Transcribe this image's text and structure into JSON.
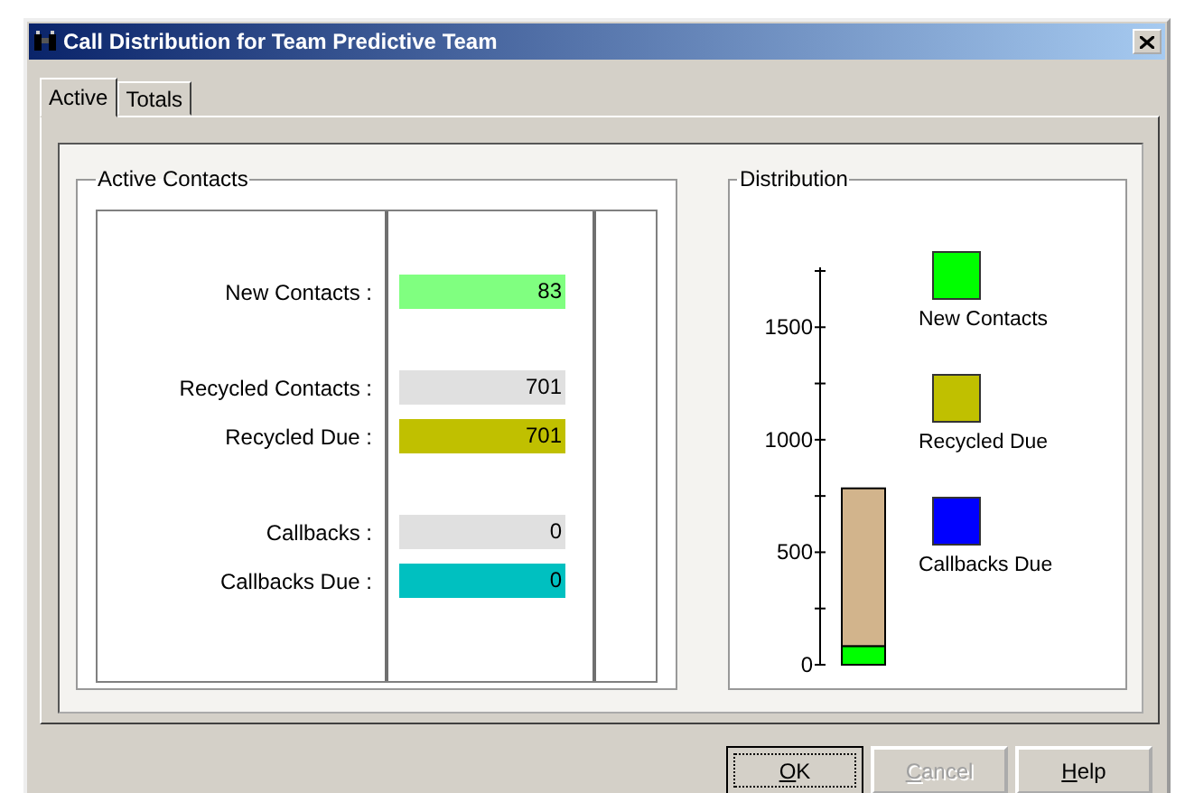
{
  "window": {
    "title": "Call Distribution for Team Predictive Team"
  },
  "tabs": [
    {
      "label": "Active",
      "selected": true
    },
    {
      "label": "Totals",
      "selected": false
    }
  ],
  "active_contacts": {
    "title": "Active Contacts",
    "groups": [
      {
        "rows": [
          {
            "label": "New Contacts :",
            "value": "83",
            "color": "#80ff80"
          }
        ]
      },
      {
        "rows": [
          {
            "label": "Recycled Contacts :",
            "value": "701",
            "color": "#e0e0e0"
          },
          {
            "label": "Recycled Due :",
            "value": "701",
            "color": "#c0c000"
          }
        ]
      },
      {
        "rows": [
          {
            "label": "Callbacks :",
            "value": "0",
            "color": "#e0e0e0"
          },
          {
            "label": "Callbacks Due :",
            "value": "0",
            "color": "#00c0c0"
          }
        ]
      }
    ]
  },
  "distribution": {
    "title": "Distribution",
    "chart_data": {
      "type": "bar",
      "stacked": true,
      "ylim": [
        0,
        1750
      ],
      "yticks": [
        0,
        500,
        1000,
        1500
      ],
      "series": [
        {
          "color": "#00ff00",
          "values": [
            83
          ]
        },
        {
          "color": "#d2b48c",
          "values": [
            701
          ]
        }
      ]
    },
    "legend": [
      {
        "label": "New Contacts",
        "color": "#00ff00"
      },
      {
        "label": "Recycled Due",
        "color": "#c0c000"
      },
      {
        "label": "Callbacks Due",
        "color": "#0000ff"
      }
    ]
  },
  "buttons": [
    {
      "label": "OK",
      "focused": true,
      "disabled": false
    },
    {
      "label": "Cancel",
      "focused": false,
      "disabled": true
    },
    {
      "label": "Help",
      "focused": false,
      "disabled": false
    }
  ]
}
